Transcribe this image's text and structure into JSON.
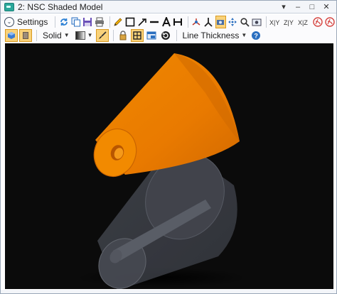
{
  "window": {
    "title": "2: NSC Shaded Model",
    "controls": [
      "▾",
      "–",
      "□",
      "✕"
    ]
  },
  "toolbar1": {
    "settings_label": "Settings"
  },
  "toolbar2": {
    "render_mode": "Solid",
    "line_thickness_label": "Line Thickness"
  },
  "colors": {
    "viewport_background": "#0b0b0b",
    "cone_upper": "#ef7f00",
    "cone_lower": "#5a5d66",
    "active_button": "#f9d27a"
  }
}
